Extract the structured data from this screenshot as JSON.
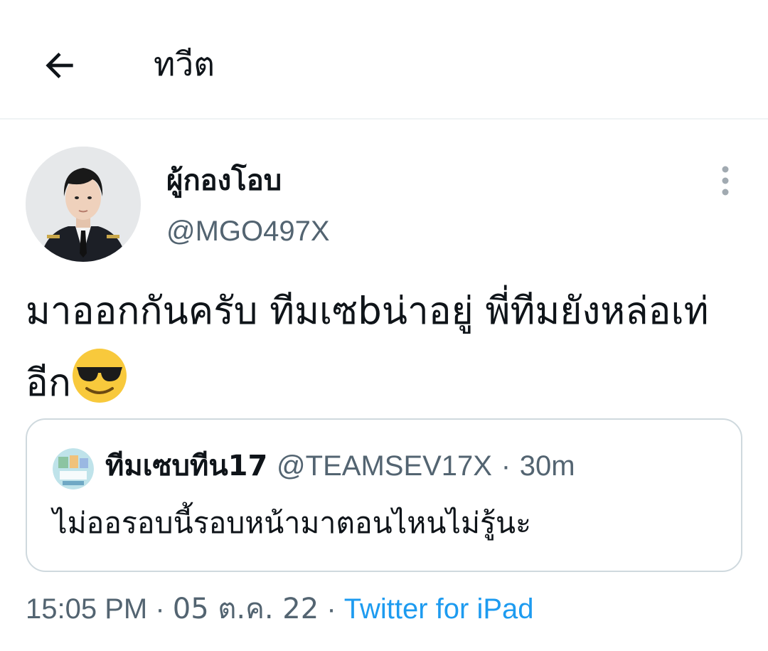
{
  "header": {
    "back_icon": "arrow-left-icon",
    "title": "ทวีต"
  },
  "tweet": {
    "display_name": "ผู้กองโอบ",
    "handle": "@MGO497X",
    "more_icon": "more-vertical-icon",
    "text": "มาออกกันครับ ทีมเซbน่าอยู่ พี่ทีมยังหล่อเท่อีก",
    "emoji": "smiling-face-with-sunglasses",
    "time": "15:05 PM",
    "separator": "·",
    "date": "05 ต.ค. 22",
    "source": "Twitter for iPad"
  },
  "quote": {
    "display_name": "ทีมเซบทีน17",
    "handle": "@TEAMSEV17X",
    "separator": "·",
    "time": "30m",
    "text": "ไม่ออรอบนี้รอบหน้ามาตอนไหนไม่รู้นะ"
  },
  "colors": {
    "text_primary": "#0f1419",
    "text_secondary": "#536471",
    "link": "#1d9bf0",
    "border": "#cfd9de",
    "divider": "#eff3f4"
  }
}
